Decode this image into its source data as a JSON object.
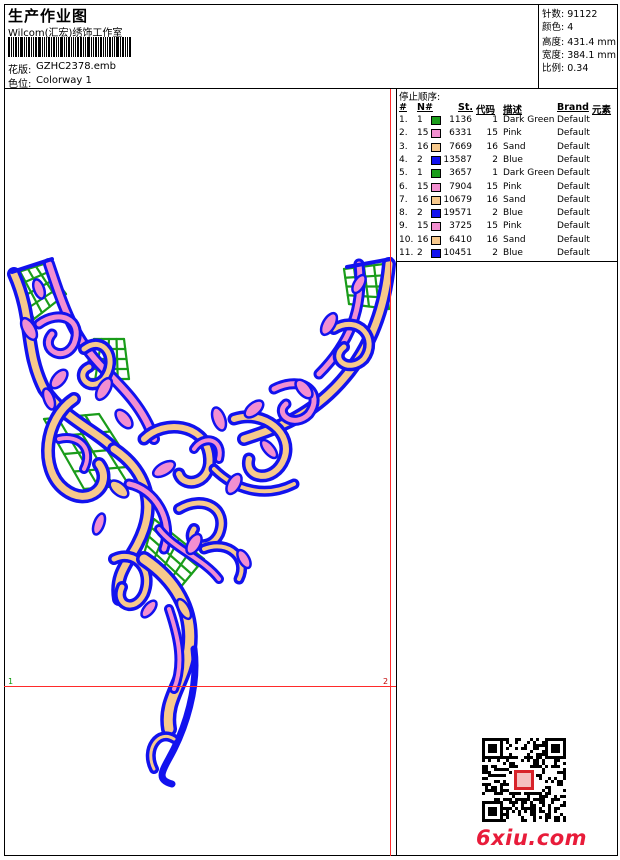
{
  "header": {
    "title": "生产作业图",
    "company": "Wilcom(汇宏)绣饰工作室",
    "design_label": "花版:",
    "design_value": "GZHC2378.emb",
    "colorway_label": "色位:",
    "colorway_value": "Colorway 1"
  },
  "stats": {
    "stitches": "针数: 91122",
    "colors": "颜色: 4",
    "height": "高度: 431.4 mm",
    "width": "宽度: 384.1 mm",
    "scale": "比例: 0.34"
  },
  "stop_sequence": {
    "title": "停止顺序:",
    "headers": [
      "#",
      "N#",
      "St.",
      "代码",
      "描述",
      "Brand",
      "元素"
    ],
    "rows": [
      {
        "idx": "1.",
        "needle": "1",
        "color": "#1a9c1a",
        "stitches": "1136",
        "code": "1",
        "desc": "Dark Green",
        "brand": "Default"
      },
      {
        "idx": "2.",
        "needle": "15",
        "color": "#f28fd0",
        "stitches": "6331",
        "code": "15",
        "desc": "Pink",
        "brand": "Default"
      },
      {
        "idx": "3.",
        "needle": "16",
        "color": "#f7c98c",
        "stitches": "7669",
        "code": "16",
        "desc": "Sand",
        "brand": "Default"
      },
      {
        "idx": "4.",
        "needle": "2",
        "color": "#1212ee",
        "stitches": "13587",
        "code": "2",
        "desc": "Blue",
        "brand": "Default"
      },
      {
        "idx": "5.",
        "needle": "1",
        "color": "#1a9c1a",
        "stitches": "3657",
        "code": "1",
        "desc": "Dark Green",
        "brand": "Default"
      },
      {
        "idx": "6.",
        "needle": "15",
        "color": "#f28fd0",
        "stitches": "7904",
        "code": "15",
        "desc": "Pink",
        "brand": "Default"
      },
      {
        "idx": "7.",
        "needle": "16",
        "color": "#f7c98c",
        "stitches": "10679",
        "code": "16",
        "desc": "Sand",
        "brand": "Default"
      },
      {
        "idx": "8.",
        "needle": "2",
        "color": "#1212ee",
        "stitches": "19571",
        "code": "2",
        "desc": "Blue",
        "brand": "Default"
      },
      {
        "idx": "9.",
        "needle": "15",
        "color": "#f28fd0",
        "stitches": "3725",
        "code": "15",
        "desc": "Pink",
        "brand": "Default"
      },
      {
        "idx": "10.",
        "needle": "16",
        "color": "#f7c98c",
        "stitches": "6410",
        "code": "16",
        "desc": "Sand",
        "brand": "Default"
      },
      {
        "idx": "11.",
        "needle": "2",
        "color": "#1212ee",
        "stitches": "10451",
        "code": "2",
        "desc": "Blue",
        "brand": "Default"
      }
    ]
  },
  "design": {
    "corner_label_left": "1",
    "corner_label_right": "2",
    "thread_colors": {
      "blue": "#1212ee",
      "pink": "#f28fd0",
      "sand": "#f7c98c",
      "green": "#1a9c1a"
    }
  },
  "watermark": {
    "text": "6xiu.com",
    "qr_icon": "qr-code-icon",
    "seal_icon": "red-seal-icon"
  }
}
